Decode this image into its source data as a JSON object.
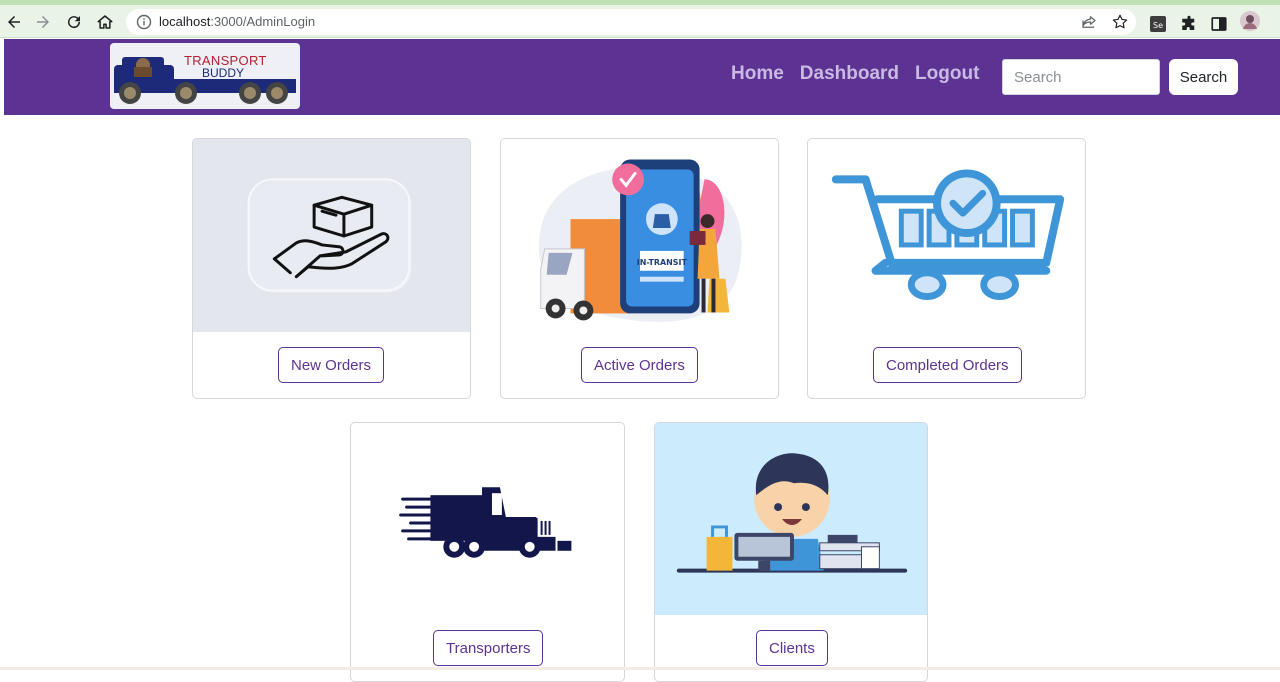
{
  "browser": {
    "url_host": "localhost",
    "url_path": ":3000/AdminLogin"
  },
  "navbar": {
    "logo_line1": "TRANSPORT",
    "logo_line2": "BUDDY",
    "links": [
      "Home",
      "Dashboard",
      "Logout"
    ],
    "search_placeholder": "Search",
    "search_button": "Search",
    "brand_color": "#5c3392"
  },
  "cards": [
    {
      "label": "New Orders",
      "icon": "hand-box-icon"
    },
    {
      "label": "Active Orders",
      "icon": "in-transit-phone-icon",
      "image_text": "IN-TRANSIT"
    },
    {
      "label": "Completed Orders",
      "icon": "shopping-cart-check-icon"
    },
    {
      "label": "Transporters",
      "icon": "truck-icon"
    },
    {
      "label": "Clients",
      "icon": "client-boy-icon"
    }
  ]
}
